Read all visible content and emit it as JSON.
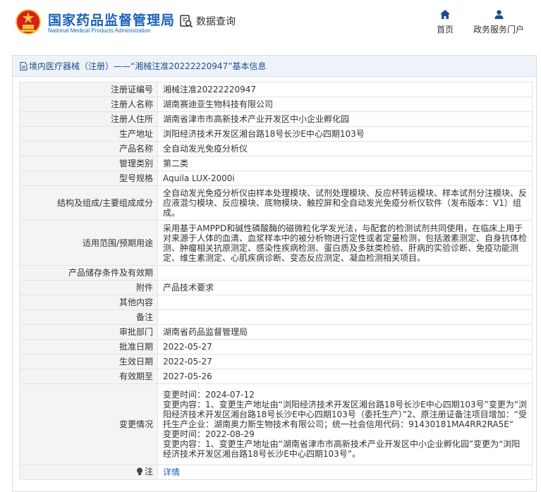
{
  "header": {
    "site_name": "国家药品监督管理局",
    "site_name_en": "National Medical Products Administration",
    "search_label": "数据查询",
    "nav": [
      {
        "label": "首页",
        "icon": "home-icon"
      },
      {
        "label": "政务服务门户",
        "icon": "user-icon"
      }
    ]
  },
  "panel": {
    "title": "境内医疗器械（注册）——“湘械注准20222220947”基本信息"
  },
  "rows": [
    {
      "label": "注册证编号",
      "value": "湘械注准20222220947"
    },
    {
      "label": "注册人名称",
      "value": "湖南赛迪亚生物科技有限公司"
    },
    {
      "label": "注册人住所",
      "value": "湖南省津市市高新技术产业开发区中小企业孵化园"
    },
    {
      "label": "生产地址",
      "value": "浏阳经济技术开发区湘台路18号长沙E中心四期103号"
    },
    {
      "label": "产品名称",
      "value": "全自动发光免疫分析仪"
    },
    {
      "label": "管理类别",
      "value": "第二类"
    },
    {
      "label": "型号规格",
      "value": "Aquila LUX-2000i"
    },
    {
      "label": "结构及组成/主要组成成分",
      "value": "全自动发光免疫分析仪由样本处理模块、试剂处理模块、反应杯转运模块、样本试剂分注模块、反应液混匀模块、反应模块、底物模块、触控屏和全自动发光免疫分析仪软件（发布版本：V1）组成。"
    },
    {
      "label": "适用范围/预期用途",
      "value": "采用基于AMPPD和碱性磷酸酶的磁微粒化学发光法，与配套的检测试剂共同使用，在临床上用于对来源于人体的血清、血浆样本中的被分析物进行定性或者定量检测，包括激素测定、自身抗体检测、肿瘤相关抗原测定、感染性疾病检测、蛋白质及多肽类检验、肝病的实验诊断、免疫功能测定、维生素测定、心肌疾病诊断、变态反应测定、凝血检测相关项目。"
    },
    {
      "label": "产品储存条件及有效期",
      "value": ""
    },
    {
      "label": "附件",
      "value": "产品技术要求"
    },
    {
      "label": "其他内容",
      "value": ""
    },
    {
      "label": "备注",
      "value": ""
    },
    {
      "label": "审批部门",
      "value": "湖南省药品监督管理局"
    },
    {
      "label": "批准日期",
      "value": "2022-05-27"
    },
    {
      "label": "生效日期",
      "value": "2022-05-27"
    },
    {
      "label": "有效期至",
      "value": "2027-05-26"
    },
    {
      "label": "变更情况",
      "value": "变更时间：2024-07-12\n变更内容：1、变更生产地址由“浏阳经济技术开发区湘台路18号长沙E中心四期103号”变更为“浏阳经济技术开发区湘台路18号长沙E中心四期103号（委托生产）”2、原注册证备注项目增加：“受托生产企业：湖南奥力斯生物技术有限公司；统一社会信用代码：91430181MA4RR2RA5E“\n变更时间：2022-08-29\n变更内容：1、变更生产地址由“湖南省津市市高新技术产业开发区中小企业孵化园”变更为“浏阳经济技术开发区湘台路18号长沙E中心四期103号”。"
    },
    {
      "label": "注",
      "value": "详情"
    }
  ],
  "colors": {
    "brand_blue": "#1a62b8",
    "emblem_red": "#d7201f",
    "emblem_gold": "#f3c53c"
  }
}
